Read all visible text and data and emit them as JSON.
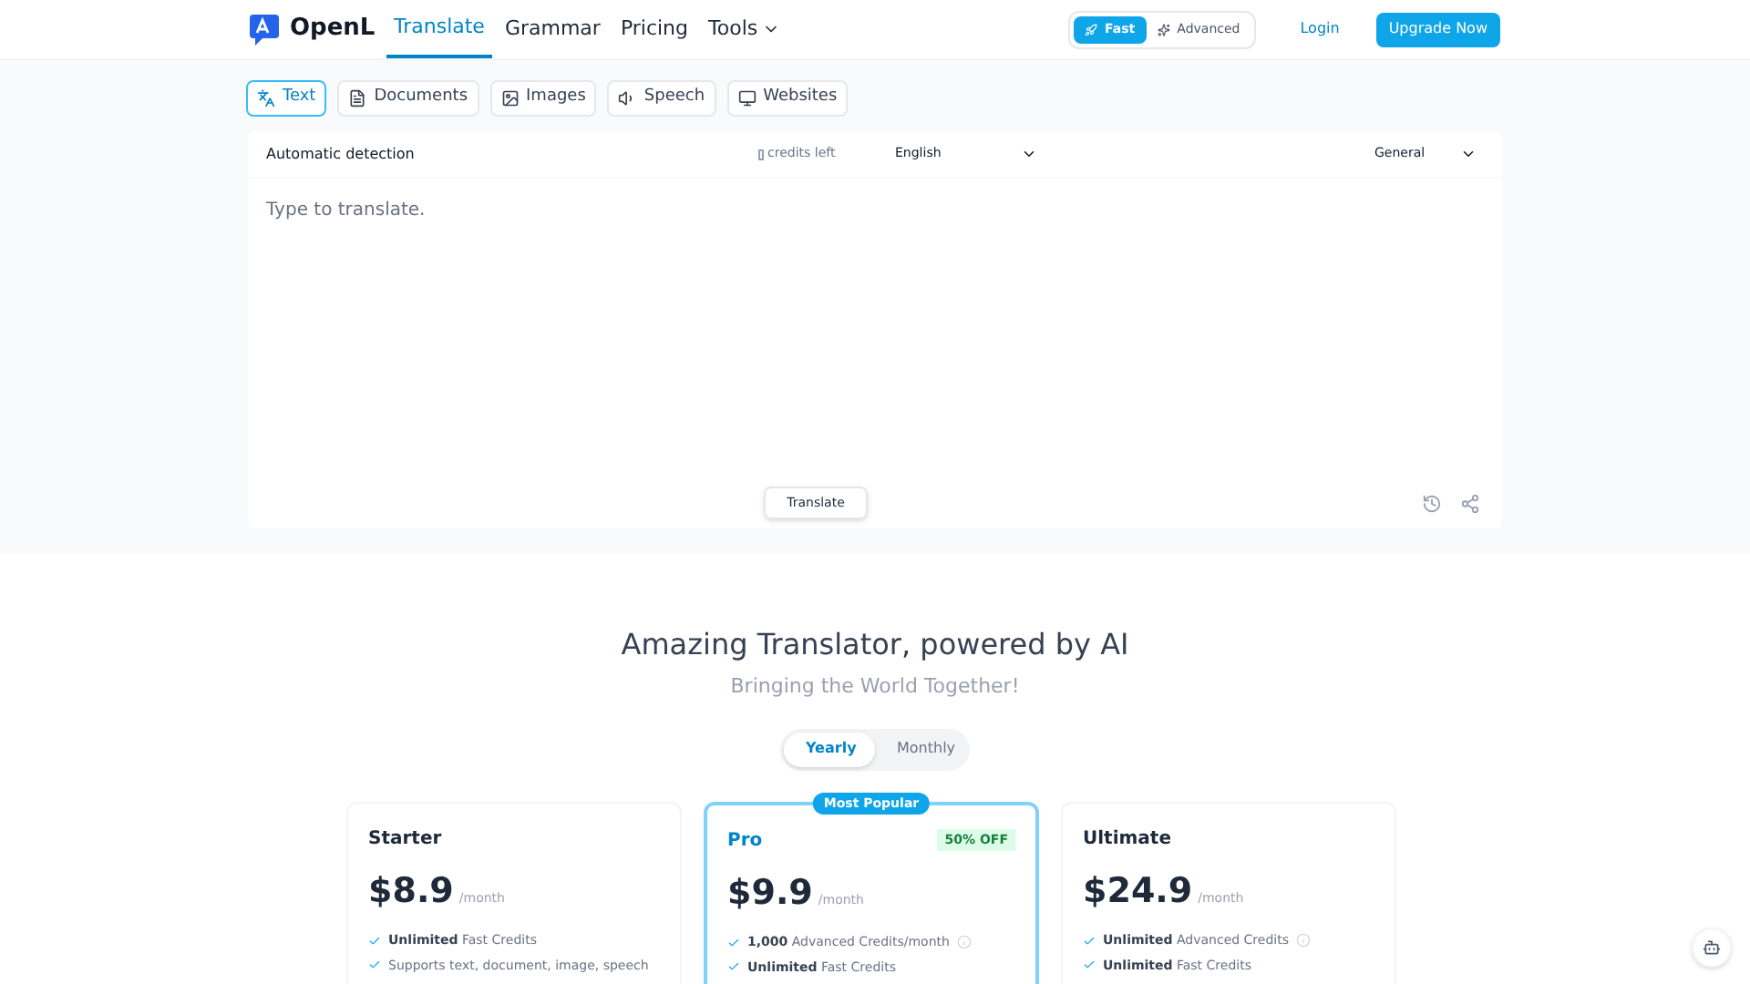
{
  "header": {
    "logo": "OpenL",
    "nav": [
      {
        "label": "Translate",
        "selected": true,
        "dropdown": false
      },
      {
        "label": "Grammar",
        "selected": false,
        "dropdown": false
      },
      {
        "label": "Pricing",
        "selected": false,
        "dropdown": false
      },
      {
        "label": "Tools",
        "selected": false,
        "dropdown": true
      }
    ],
    "modes": [
      {
        "label": "Fast",
        "selected": true
      },
      {
        "label": "Advanced",
        "selected": false
      }
    ],
    "login": "Login",
    "upgrade": "Upgrade Now"
  },
  "input_tabs": [
    {
      "label": "Text",
      "selected": true
    },
    {
      "label": "Documents",
      "selected": false
    },
    {
      "label": "Images",
      "selected": false
    },
    {
      "label": "Speech",
      "selected": false
    },
    {
      "label": "Websites",
      "selected": false
    }
  ],
  "translator": {
    "source": "Automatic detection",
    "credits": "credits left",
    "target": "English",
    "style": "General",
    "placeholder": "Type to translate.",
    "button": "Translate"
  },
  "hero": {
    "title": "Amazing Translator, powered by AI",
    "subtitle": "Bringing the World Together!"
  },
  "billing": [
    {
      "label": "Yearly",
      "selected": true
    },
    {
      "label": "Monthly",
      "selected": false
    }
  ],
  "plans": [
    {
      "name": "Starter",
      "featured": false,
      "price": "$8.9",
      "period": "/month",
      "features": [
        {
          "text": "**Unlimited** Fast Credits",
          "info": false
        },
        {
          "text": "Supports text, document, image, speech",
          "info": false
        }
      ]
    },
    {
      "name": "Pro",
      "featured": true,
      "ribbon": "Most Popular",
      "badge": "50% OFF",
      "price": "$9.9",
      "period": "/month",
      "features": [
        {
          "text": "**1,000** Advanced Credits/month",
          "info": true
        },
        {
          "text": "**Unlimited** Fast Credits",
          "info": false
        }
      ]
    },
    {
      "name": "Ultimate",
      "featured": false,
      "price": "$24.9",
      "period": "/month",
      "features": [
        {
          "text": "**Unlimited** Advanced Credits",
          "info": true
        },
        {
          "text": "**Unlimited** Fast Credits",
          "info": false
        }
      ]
    }
  ]
}
